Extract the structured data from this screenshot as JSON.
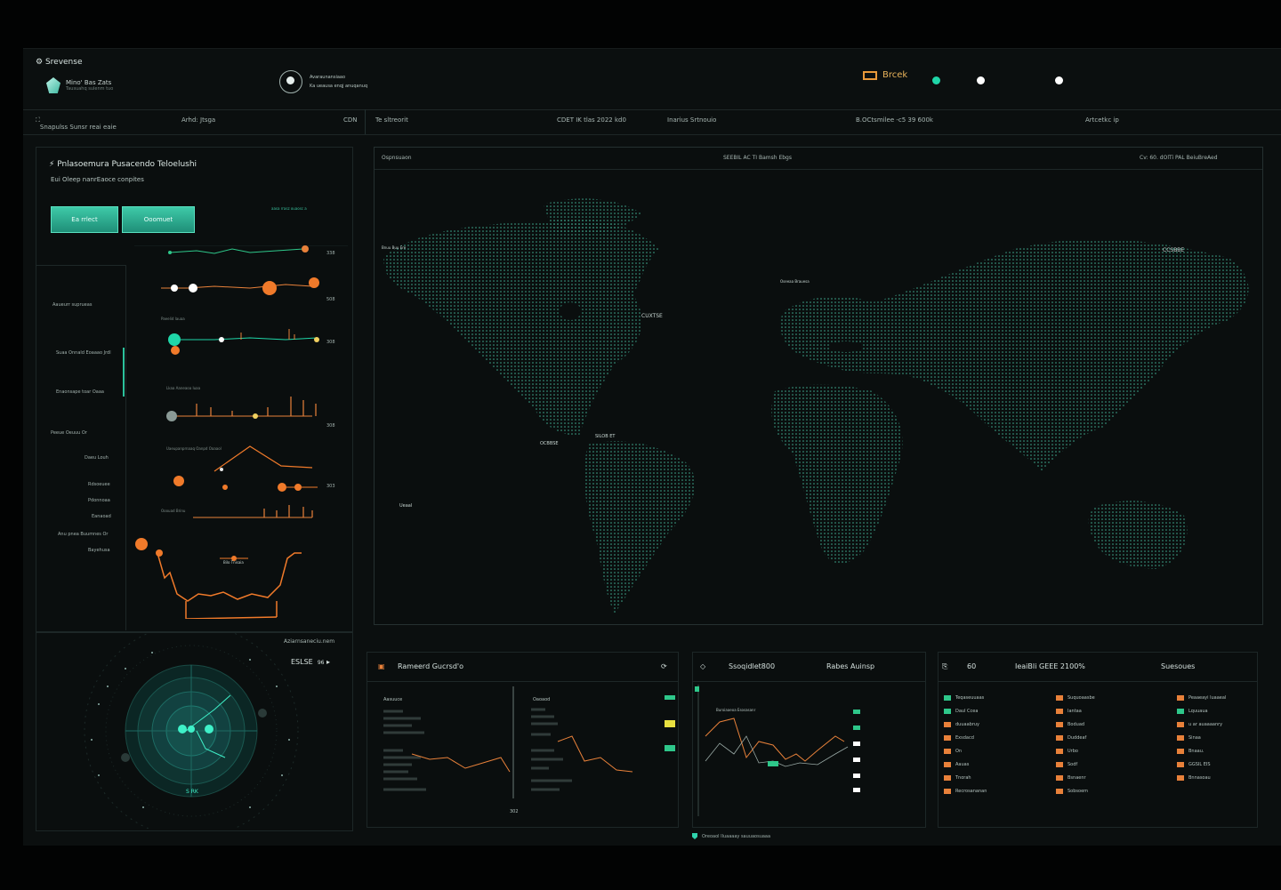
{
  "header": {
    "brand": "Srevense",
    "brand_sub": "Mino' Bas Zats",
    "brand_sub_small": "Tausuahq sulenm tuo",
    "user_name": "Avaraunansiaao",
    "user_sub": "Ka ueausa enqj anuqanuq",
    "status_label": "Brcek",
    "status_dots": [
      "#1fd6a8",
      "#ffffff",
      "#ffffff"
    ]
  },
  "nav": {
    "left_title": "Snapulss Sunsr reai eaie",
    "left_meta": "Arhd: Jtsga",
    "left_end": "CDN",
    "items": [
      "Te sltreorit",
      "CDET IK tlas 2022 kd0",
      "Inarius Srtnouio",
      "B.OCtsmilee -c5 39 600k",
      "Artcetkc ip"
    ]
  },
  "left_panel": {
    "title": "Pnlasoemura Pusacendo Teloelushi",
    "subtitle": "Eui Oleep nanrEaoce conpites",
    "button_primary": "Ea rrlect",
    "button_secondary": "Ooomuet",
    "hint": "aasa rrasz ouaosc a",
    "row_values": [
      "338",
      "508",
      "308",
      "308",
      "303"
    ],
    "side_labels": [
      "Aaueurr suprueas",
      "Suaa Onnald Eoaaao Jrdl",
      "Enaonsape toar Oaaa",
      "Peeue Oeuuu Or",
      "Daeu Louh",
      "Rdsoeuee",
      "Pdonnoaa",
      "Eanaoad",
      "Anu pnea Buumnes Or",
      "Bayehusa"
    ],
    "chart_notes": [
      "Paeelid lauaa",
      "Lkaa Aaneaoa Iuaa",
      "Uaeupanprnaaq Oanpd Oaaaol",
      "Ooouad Brinu",
      "Bilo Tnisaia"
    ]
  },
  "radar": {
    "title": "Aziarnsaneciu.nem",
    "reading": "ESLSE",
    "reading_unit": "96",
    "center_label": "S RK"
  },
  "map": {
    "head_left": "Ospnsuaon",
    "head_mid": "SEEBIL AC   TI   Bamsh Ebgs",
    "head_right": "Cv: 60. dOlTi PAL BeiuBreAed",
    "labels": [
      "CUXTSE",
      "CCSBBE",
      "Bnuu Buu Ere",
      "Oseeaa Brauesa",
      "SILOB ET",
      "OCBBSE",
      "Ueaal"
    ]
  },
  "bottom_panels": [
    {
      "title": "Rameerd Gucrsd'o",
      "col1": "Aasuuce",
      "col2": "Oaoaod",
      "axis": "302"
    },
    {
      "title": "Ssoqidlet800",
      "title2": "Rabes Auinsp",
      "chart_label": "Buroiaaeoa   Esosasanr"
    },
    {
      "title": "60",
      "title2": "IeaiBIi GEEE 2100%",
      "title3": "Suesoues"
    }
  ],
  "legend": {
    "col1": [
      {
        "label": "Teqaseuuaas",
        "color": "#2ec78a"
      },
      {
        "label": "Daul Ccea",
        "color": "#2ec78a"
      },
      {
        "label": "duuaabruy",
        "color": "#e8813a"
      },
      {
        "label": "Exsdacd",
        "color": "#e8813a"
      },
      {
        "label": "On",
        "color": "#e8813a"
      },
      {
        "label": "Aauas",
        "color": "#e8813a"
      },
      {
        "label": "Tnorah",
        "color": "#e8813a"
      },
      {
        "label": "Recrosananan",
        "color": "#e8813a"
      }
    ],
    "col2": [
      {
        "label": "Suquoaasbe",
        "color": "#e8813a"
      },
      {
        "label": "Iantaa",
        "color": "#e8813a"
      },
      {
        "label": "Boduad",
        "color": "#e8813a"
      },
      {
        "label": "Duddeaf",
        "color": "#e8813a"
      },
      {
        "label": "Urbo",
        "color": "#e8813a"
      },
      {
        "label": "Sodf",
        "color": "#e8813a"
      },
      {
        "label": "Bsnaenr",
        "color": "#e8813a"
      },
      {
        "label": "Sobsoem",
        "color": "#e8813a"
      }
    ],
    "col3": [
      {
        "label": "Peaaeayi luaaeal",
        "color": "#e8813a"
      },
      {
        "label": "Lquuaua",
        "color": "#2ec78a"
      },
      {
        "label": "u ar auaaaanry",
        "color": "#e8813a"
      },
      {
        "label": "Sinaa",
        "color": "#e8813a"
      },
      {
        "label": "Bnaau.",
        "color": "#e8813a"
      },
      {
        "label": "GGSIL EIS",
        "color": "#e8813a"
      },
      {
        "label": "Bnnasoau",
        "color": "#e8813a"
      }
    ]
  },
  "footer": "Oreoaol Iluaaaay sauuaosuaaa"
}
